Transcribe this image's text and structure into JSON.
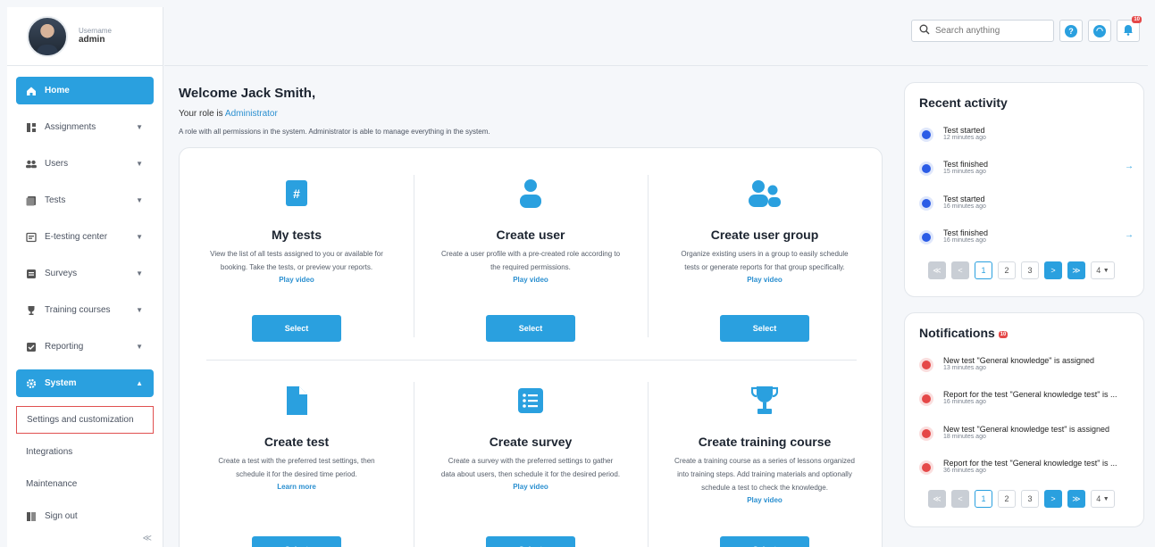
{
  "user": {
    "caption": "Username",
    "name": "admin"
  },
  "sidebar": {
    "items": [
      {
        "label": "Home",
        "icon": "home-icon"
      },
      {
        "label": "Assignments",
        "icon": "assignments-icon"
      },
      {
        "label": "Users",
        "icon": "users-icon"
      },
      {
        "label": "Tests",
        "icon": "tests-icon"
      },
      {
        "label": "E-testing center",
        "icon": "etesting-icon"
      },
      {
        "label": "Surveys",
        "icon": "surveys-icon"
      },
      {
        "label": "Training courses",
        "icon": "trophy-icon"
      },
      {
        "label": "Reporting",
        "icon": "reporting-icon"
      },
      {
        "label": "System",
        "icon": "gear-icon"
      }
    ],
    "system_sub": [
      "Settings and customization",
      "Integrations",
      "Maintenance"
    ],
    "sign_out": "Sign out",
    "collapse": "≪"
  },
  "topbar": {
    "search_placeholder": "Search anything",
    "notif_count": "10"
  },
  "welcome": {
    "title": "Welcome Jack Smith,",
    "role_prefix": "Your role is",
    "role": "Administrator",
    "role_desc": "A role with all permissions in the system. Administrator is able to manage everything in the system."
  },
  "tiles": [
    {
      "title": "My tests",
      "desc": "View the list of all tests assigned to you or available for booking. Take the tests, or preview your reports.",
      "link": "Play video",
      "button": "Select"
    },
    {
      "title": "Create user",
      "desc": "Create a user profile with a pre-created role according to the required permissions.",
      "link": "Play video",
      "button": "Select"
    },
    {
      "title": "Create user group",
      "desc": "Organize existing users in a group to easily schedule tests or generate reports for that group specifically.",
      "link": "Play video",
      "button": "Select"
    },
    {
      "title": "Create test",
      "desc": "Create a test with the preferred test settings, then schedule it for the desired time period.",
      "link": "Learn more",
      "button": "Select"
    },
    {
      "title": "Create survey",
      "desc": "Create a survey with the preferred settings to gather data about users, then schedule it for the desired period.",
      "link": "Play video",
      "button": "Select"
    },
    {
      "title": "Create training course",
      "desc": "Create a training course as a series of lessons organized into training steps. Add training materials and optionally schedule a test to check the knowledge.",
      "link": "Play video",
      "button": "Select"
    }
  ],
  "recent_activity": {
    "title": "Recent activity",
    "items": [
      {
        "text": "Test started",
        "time": "12 minutes ago"
      },
      {
        "text": "Test finished",
        "time": "15 minutes ago"
      },
      {
        "text": "Test started",
        "time": "16 minutes ago"
      },
      {
        "text": "Test finished",
        "time": "16 minutes ago"
      }
    ]
  },
  "notifications": {
    "title": "Notifications",
    "count": "10",
    "items": [
      {
        "text": "New test \"General knowledge\" is assigned",
        "time": "13 minutes ago"
      },
      {
        "text": "Report for the test \"General knowledge test\" is ...",
        "time": "16 minutes ago"
      },
      {
        "text": "New test \"General knowledge test\" is assigned",
        "time": "18 minutes ago"
      },
      {
        "text": "Report for the test \"General knowledge test\" is ...",
        "time": "36 minutes ago"
      }
    ]
  },
  "pager": {
    "first": "≪",
    "prev": "<",
    "pages": [
      "1",
      "2",
      "3"
    ],
    "next": ">",
    "last": "≫",
    "size": "4"
  },
  "colors": {
    "accent": "#2aa0df",
    "badge": "#e54848",
    "activity_dot": "#2b5ce6"
  }
}
